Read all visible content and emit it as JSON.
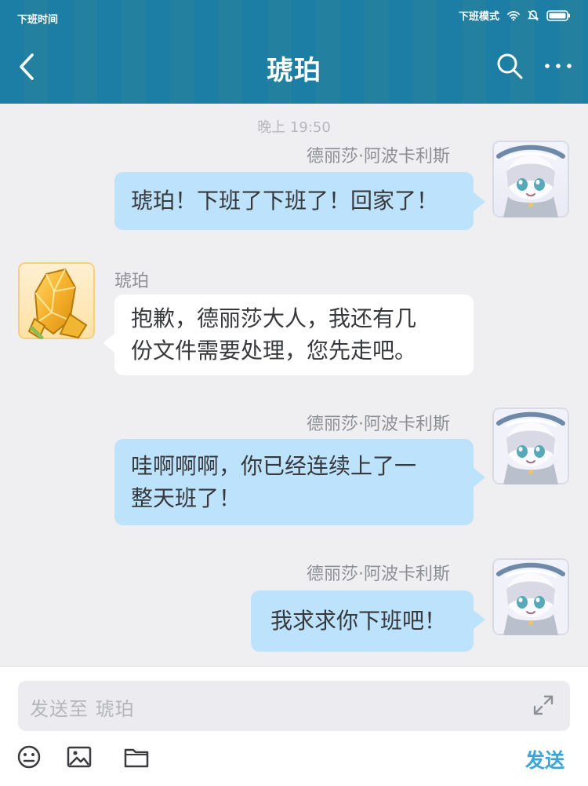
{
  "status_bar": {
    "left_text": "下班时间",
    "mode_text": "下班模式"
  },
  "header": {
    "title": "琥珀"
  },
  "chat": {
    "timestamp": "晚上  19:50",
    "messages": [
      {
        "sender": "德丽莎·阿波卡利斯",
        "text": "琥珀！下班了下班了！回家了！",
        "side": "right"
      },
      {
        "sender": "琥珀",
        "text_lines": [
          "抱歉，德丽莎大人，我还有几",
          "份文件需要处理，您先走吧。"
        ],
        "side": "left"
      },
      {
        "sender": "德丽莎·阿波卡利斯",
        "text_lines": [
          "哇啊啊啊，你已经连续上了一",
          "整天班了！"
        ],
        "side": "right"
      },
      {
        "sender": "德丽莎·阿波卡利斯",
        "text": "我求求你下班吧！",
        "side": "right"
      }
    ]
  },
  "input": {
    "placeholder": "发送至  琥珀",
    "send_label": "发送"
  },
  "colors": {
    "header": "#1c7ea4",
    "bubble_self": "#bde2fb",
    "bubble_other": "#ffffff",
    "send_text": "#3aa6d8"
  },
  "icons": {
    "header_left": "back-icon",
    "header_search": "search-icon",
    "header_more": "more-icon",
    "toolbar": [
      "emoji-icon",
      "image-icon",
      "folder-icon"
    ],
    "input_expand": "expand-icon"
  }
}
